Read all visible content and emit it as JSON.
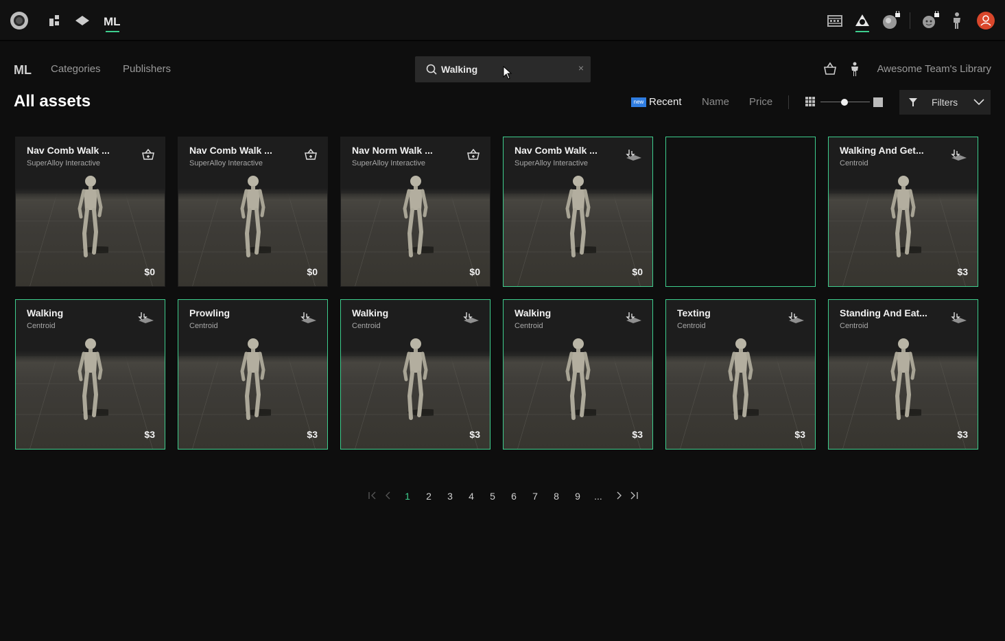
{
  "topbar": {
    "icons": [
      "logo-icon",
      "apps-icon",
      "layers-icon",
      "ml-icon",
      "film-icon",
      "library-icon",
      "locked-sphere-icon",
      "locked-face-icon",
      "character-icon",
      "user-avatar-icon"
    ]
  },
  "nav": {
    "logo": "ML",
    "categories": "Categories",
    "publishers": "Publishers",
    "library": "Awesome Team's Library"
  },
  "search": {
    "value": "Walking",
    "clear": "×"
  },
  "page": {
    "title": "All assets"
  },
  "sort": {
    "new_badge": "new",
    "recent": "Recent",
    "name": "Name",
    "price": "Price",
    "size_level": 0.5
  },
  "filters": {
    "label": "Filters"
  },
  "accent": "#3ecf8e",
  "cards": [
    {
      "title": "Nav Comb Walk ...",
      "publisher": "SuperAlloy Interactive",
      "price": "$0",
      "action": "cart",
      "owned": false
    },
    {
      "title": "Nav Comb Walk ...",
      "publisher": "SuperAlloy Interactive",
      "price": "$0",
      "action": "cart",
      "owned": false
    },
    {
      "title": "Nav Norm Walk ...",
      "publisher": "SuperAlloy Interactive",
      "price": "$0",
      "action": "cart",
      "owned": false
    },
    {
      "title": "Nav Comb Walk ...",
      "publisher": "SuperAlloy Interactive",
      "price": "$0",
      "action": "apply",
      "owned": true
    },
    {
      "title": "",
      "publisher": "",
      "price": "",
      "action": "none",
      "owned": true
    },
    {
      "title": "Walking And Get...",
      "publisher": "Centroid",
      "price": "$3",
      "action": "apply",
      "owned": true
    },
    {
      "title": "Walking",
      "publisher": "Centroid",
      "price": "$3",
      "action": "apply",
      "owned": true
    },
    {
      "title": "Prowling",
      "publisher": "Centroid",
      "price": "$3",
      "action": "apply",
      "owned": true
    },
    {
      "title": "Walking",
      "publisher": "Centroid",
      "price": "$3",
      "action": "apply",
      "owned": true
    },
    {
      "title": "Walking",
      "publisher": "Centroid",
      "price": "$3",
      "action": "apply",
      "owned": true
    },
    {
      "title": "Texting",
      "publisher": "Centroid",
      "price": "$3",
      "action": "apply",
      "owned": true
    },
    {
      "title": "Standing And Eat...",
      "publisher": "Centroid",
      "price": "$3",
      "action": "apply",
      "owned": true
    }
  ],
  "pagination": {
    "pages": [
      "1",
      "2",
      "3",
      "4",
      "5",
      "6",
      "7",
      "8",
      "9",
      "..."
    ],
    "current": "1"
  }
}
